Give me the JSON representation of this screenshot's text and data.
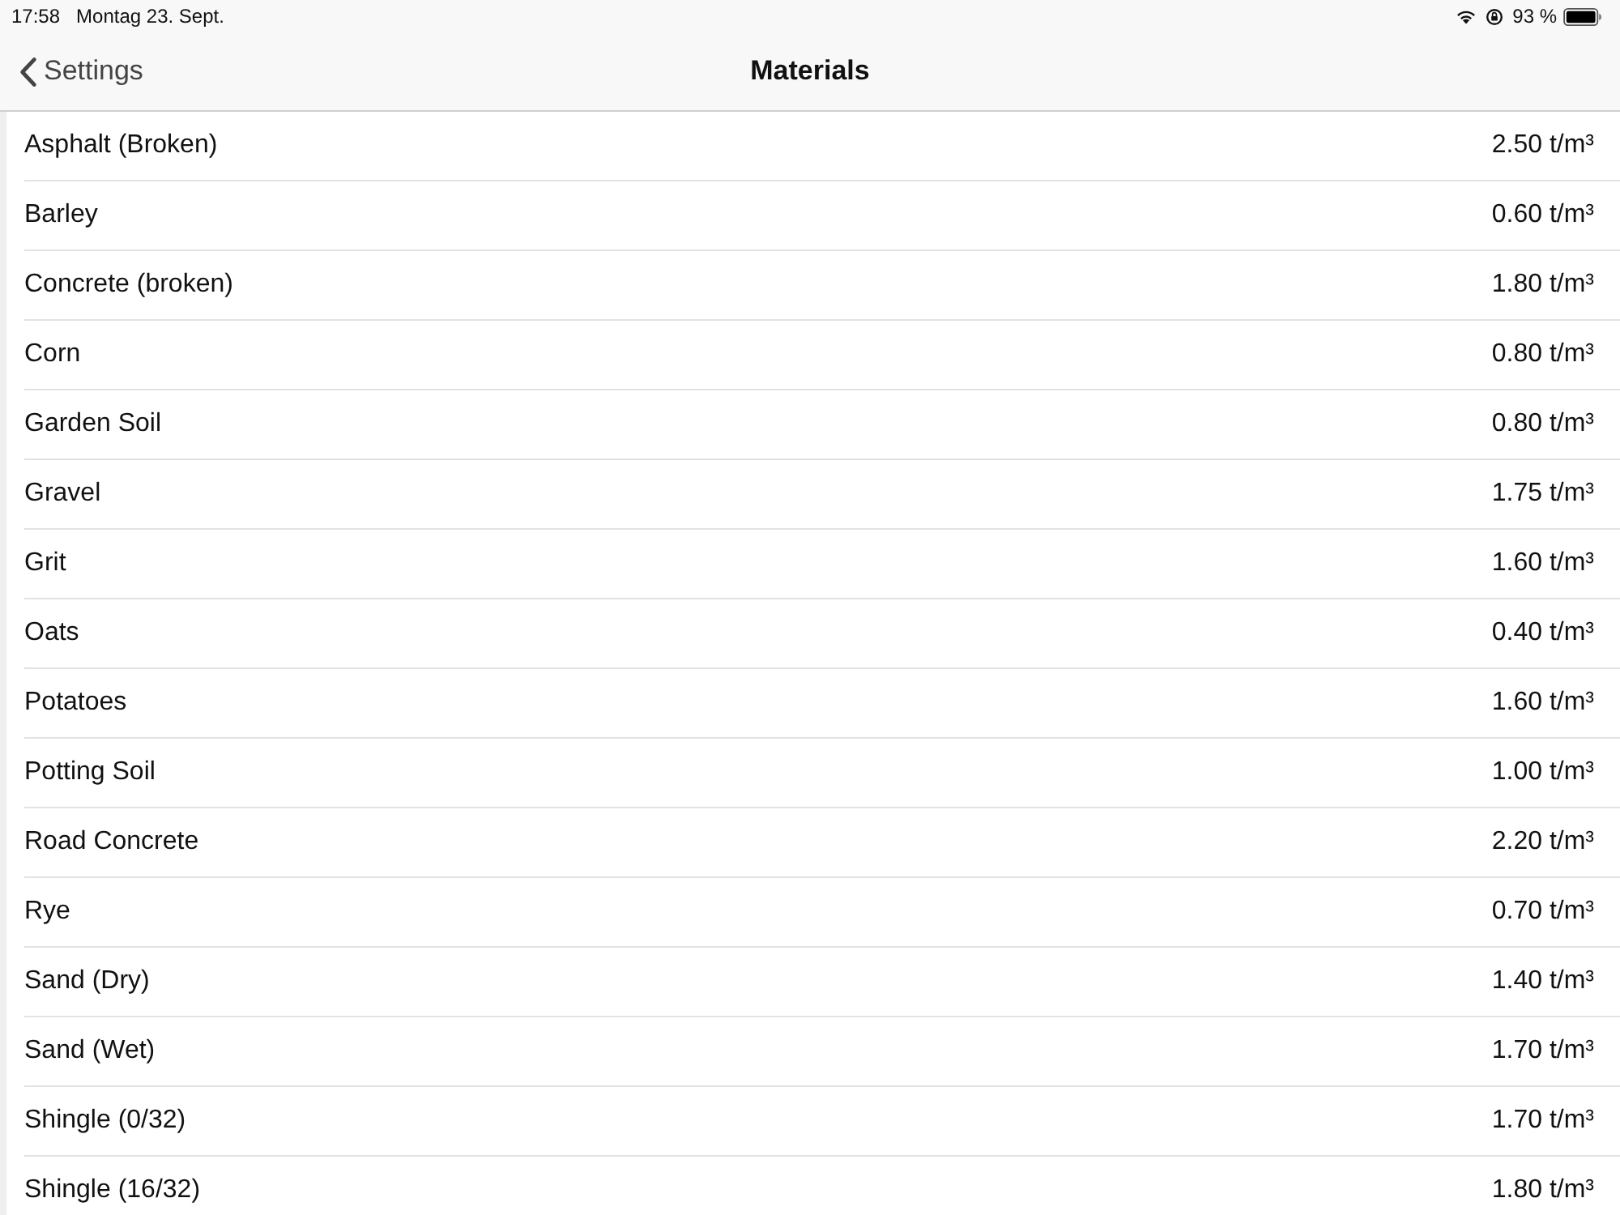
{
  "status_bar": {
    "time": "17:58",
    "date": "Montag 23. Sept.",
    "battery": "93 %"
  },
  "nav_bar": {
    "back": "Settings",
    "title": "Materials"
  },
  "materials": [
    {
      "name": "Asphalt (Broken)",
      "density": "2.50 t/m³"
    },
    {
      "name": "Barley",
      "density": "0.60 t/m³"
    },
    {
      "name": "Concrete (broken)",
      "density": "1.80 t/m³"
    },
    {
      "name": "Corn",
      "density": "0.80 t/m³"
    },
    {
      "name": "Garden Soil",
      "density": "0.80 t/m³"
    },
    {
      "name": "Gravel",
      "density": "1.75 t/m³"
    },
    {
      "name": "Grit",
      "density": "1.60 t/m³"
    },
    {
      "name": "Oats",
      "density": "0.40 t/m³"
    },
    {
      "name": "Potatoes",
      "density": "1.60 t/m³"
    },
    {
      "name": "Potting Soil",
      "density": "1.00 t/m³"
    },
    {
      "name": "Road Concrete",
      "density": "2.20 t/m³"
    },
    {
      "name": "Rye",
      "density": "0.70 t/m³"
    },
    {
      "name": "Sand (Dry)",
      "density": "1.40 t/m³"
    },
    {
      "name": "Sand (Wet)",
      "density": "1.70 t/m³"
    },
    {
      "name": "Shingle (0/32)",
      "density": "1.70 t/m³"
    },
    {
      "name": "Shingle (16/32)",
      "density": "1.80 t/m³"
    }
  ]
}
